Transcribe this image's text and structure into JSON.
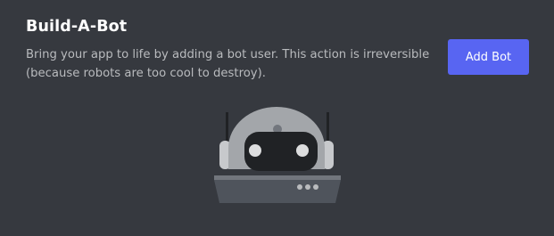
{
  "section": {
    "title": "Build-A-Bot",
    "description": "Bring your app to life by adding a bot user. This action is irreversible (because robots are too cool to destroy).",
    "add_bot_label": "Add Bot"
  },
  "colors": {
    "background": "#36393f",
    "title": "#ffffff",
    "description": "#b9bbbe",
    "button": "#5865f2",
    "button_text": "#ffffff",
    "robot_head": "#a3a6aa",
    "robot_face": "#202225",
    "robot_base": "#4f545c"
  },
  "illustration": {
    "icon": "robot-icon"
  }
}
